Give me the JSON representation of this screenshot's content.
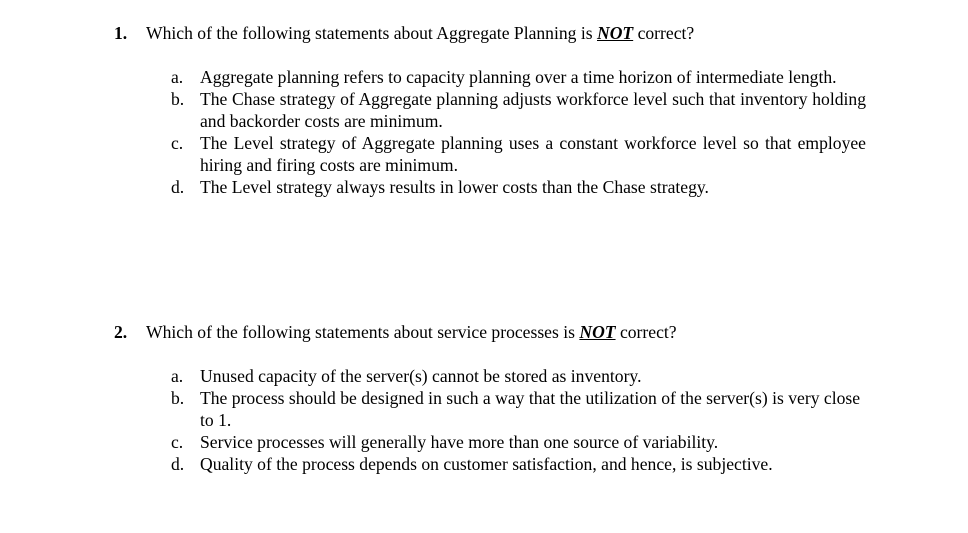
{
  "document": {
    "background_color": "#ffffff",
    "text_color": "#000000"
  },
  "questions": [
    {
      "number": "1.",
      "stem_before": "Which of the following statements about Aggregate Planning is ",
      "stem_emphasis": "NOT",
      "stem_after": " correct?",
      "options": [
        {
          "letter": "a.",
          "text": "Aggregate planning refers to capacity planning over a time horizon of intermediate length."
        },
        {
          "letter": "b.",
          "text": "The Chase strategy of Aggregate planning adjusts workforce level such that inventory holding and backorder costs are minimum."
        },
        {
          "letter": "c.",
          "text": "The Level strategy of Aggregate planning uses a constant workforce level so that employee hiring and firing costs are minimum."
        },
        {
          "letter": "d.",
          "text": "The Level strategy always results in lower costs than the Chase strategy."
        }
      ]
    },
    {
      "number": "2.",
      "stem_before": "Which of the following statements about service processes is ",
      "stem_emphasis": "NOT",
      "stem_after": " correct?",
      "options": [
        {
          "letter": "a.",
          "text": "Unused capacity of the server(s) cannot be stored as inventory."
        },
        {
          "letter": "b.",
          "text": "The process should be designed in such a way that the utilization of the server(s) is very close to 1."
        },
        {
          "letter": "c.",
          "text": "Service processes will generally have more than one source of variability."
        },
        {
          "letter": "d.",
          "text": "Quality of the process depends on customer satisfaction, and hence, is subjective."
        }
      ]
    }
  ]
}
